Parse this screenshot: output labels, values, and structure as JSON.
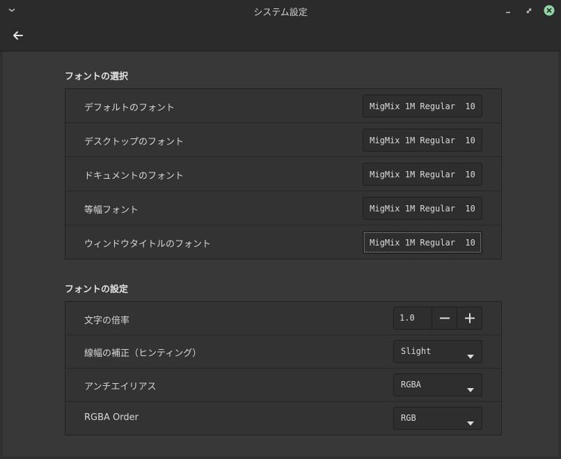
{
  "window": {
    "title": "システム設定"
  },
  "sections": {
    "font_selection": {
      "title": "フォントの選択",
      "rows": [
        {
          "label": "デフォルトのフォント",
          "value": "MigMix 1M Regular  10"
        },
        {
          "label": "デスクトップのフォント",
          "value": "MigMix 1M Regular  10"
        },
        {
          "label": "ドキュメントのフォント",
          "value": "MigMix 1M Regular  10"
        },
        {
          "label": "等幅フォント",
          "value": "MigMix 1M Regular  10"
        },
        {
          "label": "ウィンドウタイトルのフォント",
          "value": "MigMix 1M Regular  10"
        }
      ]
    },
    "font_settings": {
      "title": "フォントの設定",
      "text_scale": {
        "label": "文字の倍率",
        "value": "1.0"
      },
      "hinting": {
        "label": "線幅の補正（ヒンティング）",
        "value": "Slight"
      },
      "antialiasing": {
        "label": "アンチエイリアス",
        "value": "RGBA"
      },
      "rgba_order": {
        "label": "RGBA Order",
        "value": "RGB"
      }
    }
  },
  "icons": {
    "menu": "chevron-down-icon",
    "minimize": "minimize-icon",
    "maximize": "maximize-icon",
    "close": "close-icon",
    "back": "back-arrow-icon"
  },
  "colors": {
    "close_button": "#8fd8a6",
    "background": "#383838",
    "panel": "#333333"
  }
}
